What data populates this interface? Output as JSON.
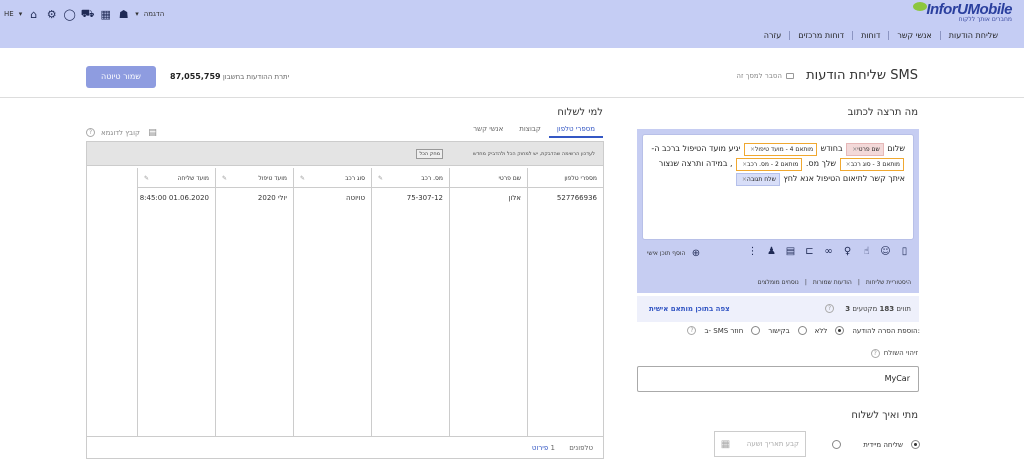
{
  "header": {
    "logo": {
      "brand": "InforUMobile",
      "tagline": "מחברים אותך ללקוח"
    },
    "lang": "HE",
    "help_menu": "הדגמה",
    "icons": [
      "home-icon",
      "gear-icon",
      "chat-icon",
      "cart-icon",
      "apps-icon",
      "users-icon"
    ]
  },
  "nav": {
    "items": [
      "שליחת הודעות",
      "אנשי קשר",
      "דוחות",
      "דוחות מרכזים",
      "עזרה"
    ]
  },
  "page": {
    "title": "שליחת הודעות SMS",
    "help_video": "הסבר למסך זה",
    "save_draft": "שמור טיוטה",
    "balance_label": "יתרת ההודעות בחשבון",
    "balance_value": "87,055,759"
  },
  "compose": {
    "heading": "מה תרצה לכתוב",
    "text": {
      "p1": "שלום",
      "p2": "בחודש",
      "p3": "יגיע מועד הטיפול ברכב ה-",
      "p4": "שלך מס.",
      "p5": ", במידה ותרצה שנצור איתך קשר לתיאום הטיפול אנא לחץ"
    },
    "tags": {
      "t_name": "שם פרטי",
      "t4": "מותאם 4 - מועד טיפול",
      "t3": "מותאם 3 - סוג רכב",
      "t2": "מותאם 2 - מס. רכב",
      "t_reply": "שלח תגובה"
    },
    "add_personal": "הוסף תוכן אישי",
    "sublinks": [
      "היסטוריית שליחות",
      "הודעות שמורות",
      "נוסחים מומלצים"
    ],
    "chars_label": "תווים",
    "chars_value": "183",
    "segments_label": "מקטעים",
    "segments_value": "3",
    "preview_link": "צפה בתוכן מותאם אישית"
  },
  "options": {
    "removal_label": "הוספת הסרה להודעה:",
    "none": "ללא",
    "link": "בקישור",
    "sms_back": "ב- SMS חוזר",
    "sender_label": "זיהוי השולח",
    "sender_value": "MyCar"
  },
  "when": {
    "heading": "מתי ואיך לשלוח",
    "now": "שליחה מיידית",
    "schedule_placeholder": "קבע תאריך ושעה"
  },
  "recipients": {
    "heading": "למי לשלוח",
    "tabs": [
      "מספרי טלפון",
      "קבוצות",
      "אנשי קשר"
    ],
    "example_file": "קובץ לדוגמא",
    "toolbar_tip": "לעדכון הרשימה שהדבקת, יש למחוק הכל ולהדביק מחדש",
    "clear_all": "מחק הכל",
    "columns": [
      "מספרי טלפון",
      "שם פרטי",
      "מס. רכב",
      "סוג רכב",
      "מועד טיפול",
      "מועד שליחה"
    ],
    "row": [
      "527766936",
      "אלון",
      "75-307-12",
      "טויוטה",
      "יולי 2020",
      "8:45:00 01.06.2020"
    ],
    "footer_label": "טלפונים",
    "footer_count": "1",
    "footer_link": "פירוט"
  }
}
